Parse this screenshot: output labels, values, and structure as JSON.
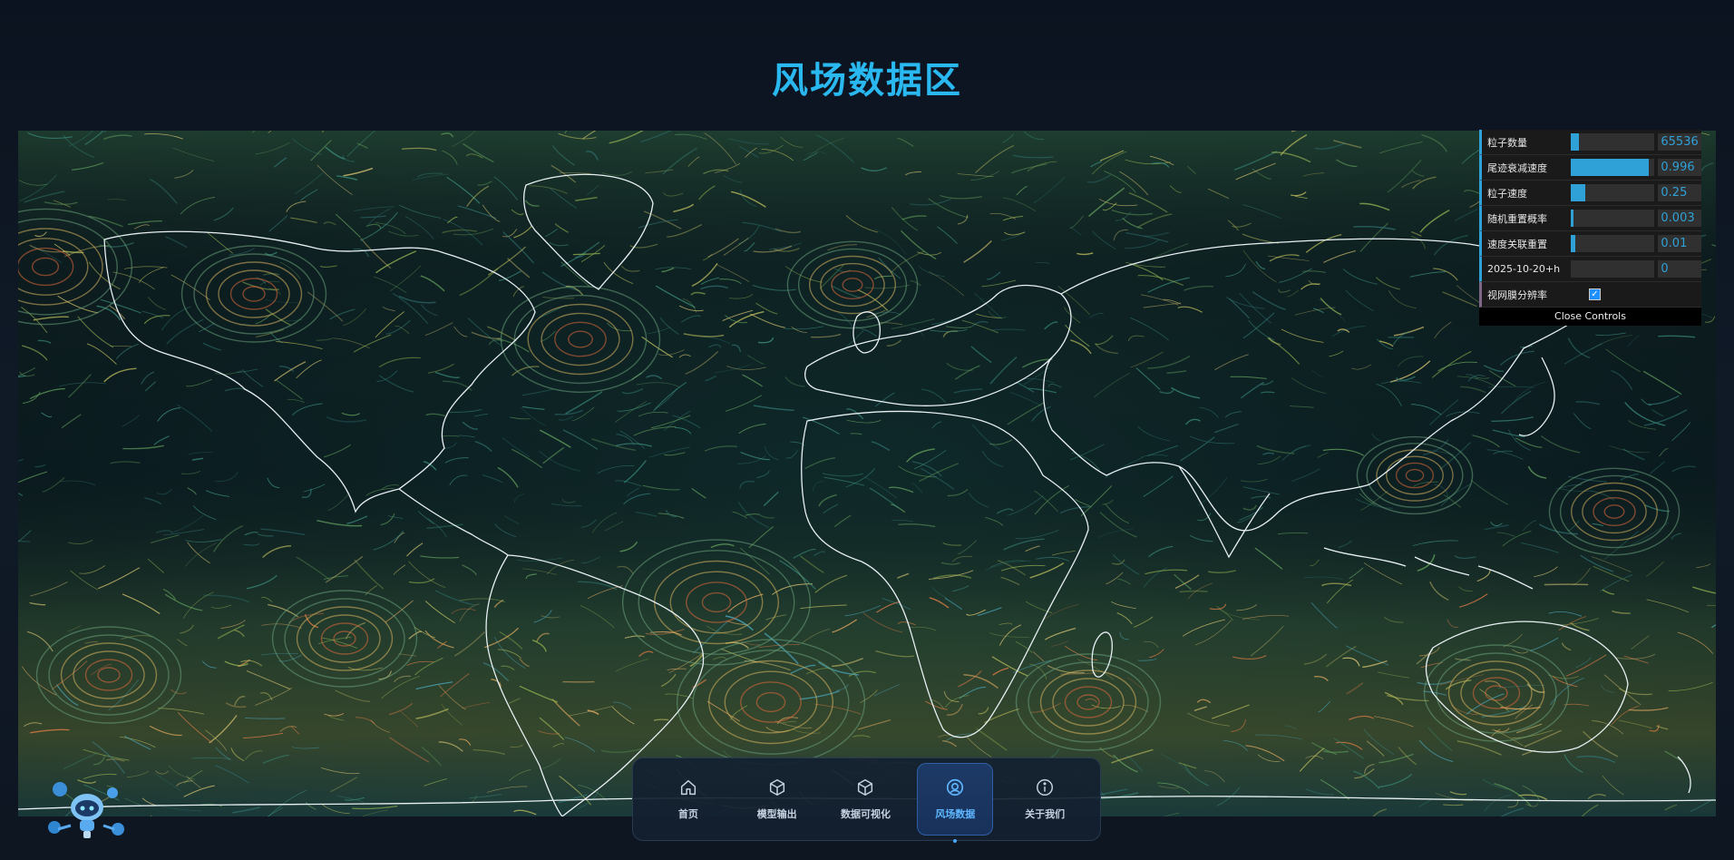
{
  "page": {
    "title": "风场数据区"
  },
  "controls": {
    "rows": [
      {
        "label": "粒子数量",
        "value": "65536",
        "fill": 0.1
      },
      {
        "label": "尾迹衰减速度",
        "value": "0.996",
        "fill": 0.93
      },
      {
        "label": "粒子速度",
        "value": "0.25",
        "fill": 0.17
      },
      {
        "label": "随机重置概率",
        "value": "0.003",
        "fill": 0.03
      },
      {
        "label": "速度关联重置",
        "value": "0.01",
        "fill": 0.05
      },
      {
        "label": "2025-10-20+h",
        "value": "0",
        "fill": 0
      }
    ],
    "retina_label": "视网膜分辨率",
    "retina_checked": true,
    "close_label": "Close Controls"
  },
  "nav": {
    "items": [
      {
        "label": "首页",
        "icon": "home-icon"
      },
      {
        "label": "模型输出",
        "icon": "cube-icon"
      },
      {
        "label": "数据可视化",
        "icon": "cube-icon"
      },
      {
        "label": "风场数据",
        "icon": "target-icon",
        "active": true
      },
      {
        "label": "关于我们",
        "icon": "info-icon"
      }
    ]
  },
  "colors": {
    "accent": "#2ab8f0",
    "panel_accent": "#2fa1d6"
  }
}
